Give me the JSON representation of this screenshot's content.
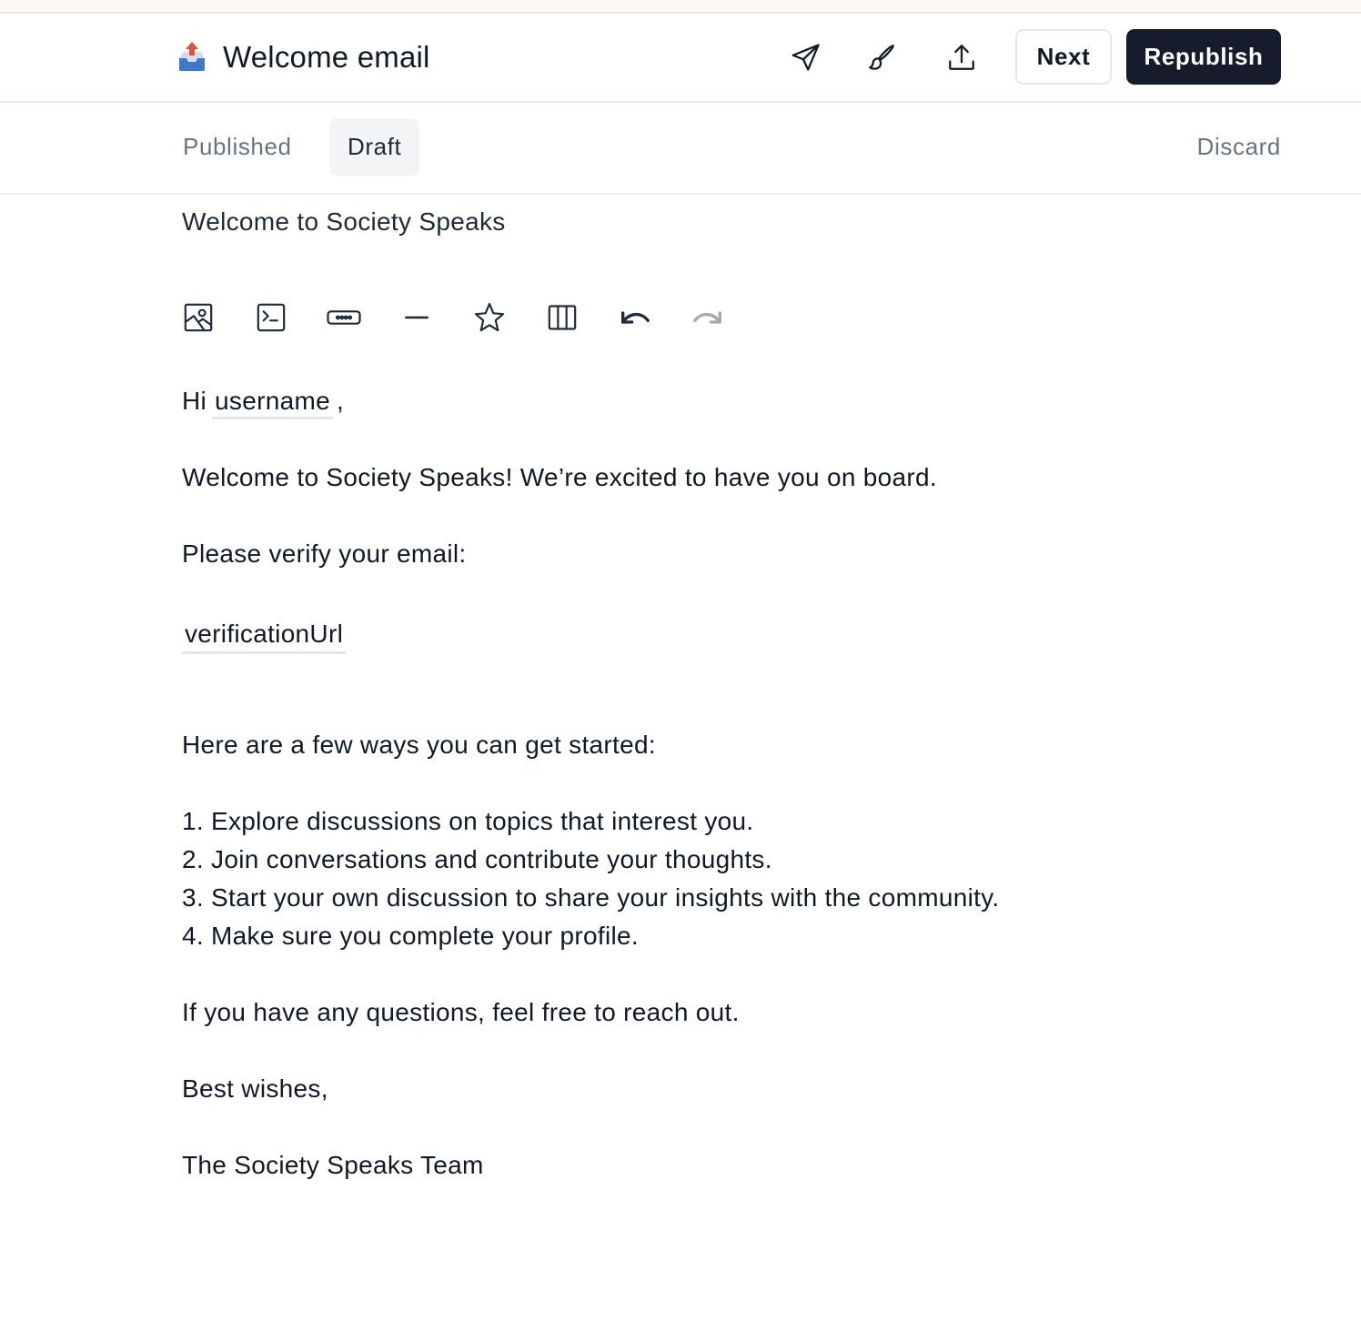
{
  "header": {
    "title": "Welcome email",
    "next_label": "Next",
    "republish_label": "Republish",
    "icons": [
      "outbox-tray-icon",
      "send-icon",
      "brush-icon",
      "upload-icon"
    ]
  },
  "tabs": {
    "published_label": "Published",
    "draft_label": "Draft",
    "active": "Draft",
    "discard_label": "Discard"
  },
  "subject": "Welcome to Society Speaks",
  "toolbar": {
    "tools": [
      "image-icon",
      "code-block-icon",
      "button-icon",
      "divider-icon",
      "star-icon",
      "columns-icon",
      "undo-icon",
      "redo-icon"
    ]
  },
  "email": {
    "greeting_prefix": "Hi",
    "greeting_variable": "username",
    "greeting_suffix": ",",
    "line_welcome": "Welcome to Society Speaks! We’re excited to have you on board.",
    "line_verify": "Please verify your email:",
    "verification_variable": "verificationUrl",
    "line_started": "Here are a few ways you can get started:",
    "list": [
      "1. Explore discussions on topics that interest you.",
      "2. Join conversations and contribute your thoughts.",
      "3. Start your own discussion to share your insights with the community.",
      "4. Make sure you complete your profile."
    ],
    "line_questions": "If you have any questions, feel free to reach out.",
    "signoff": "Best wishes,",
    "signature": "The Society Speaks Team"
  },
  "colors": {
    "primary_button": "#161c2c",
    "active_tab_bg": "#f3f4f6",
    "muted_text": "#6b7280",
    "border": "#e4e6ea"
  }
}
